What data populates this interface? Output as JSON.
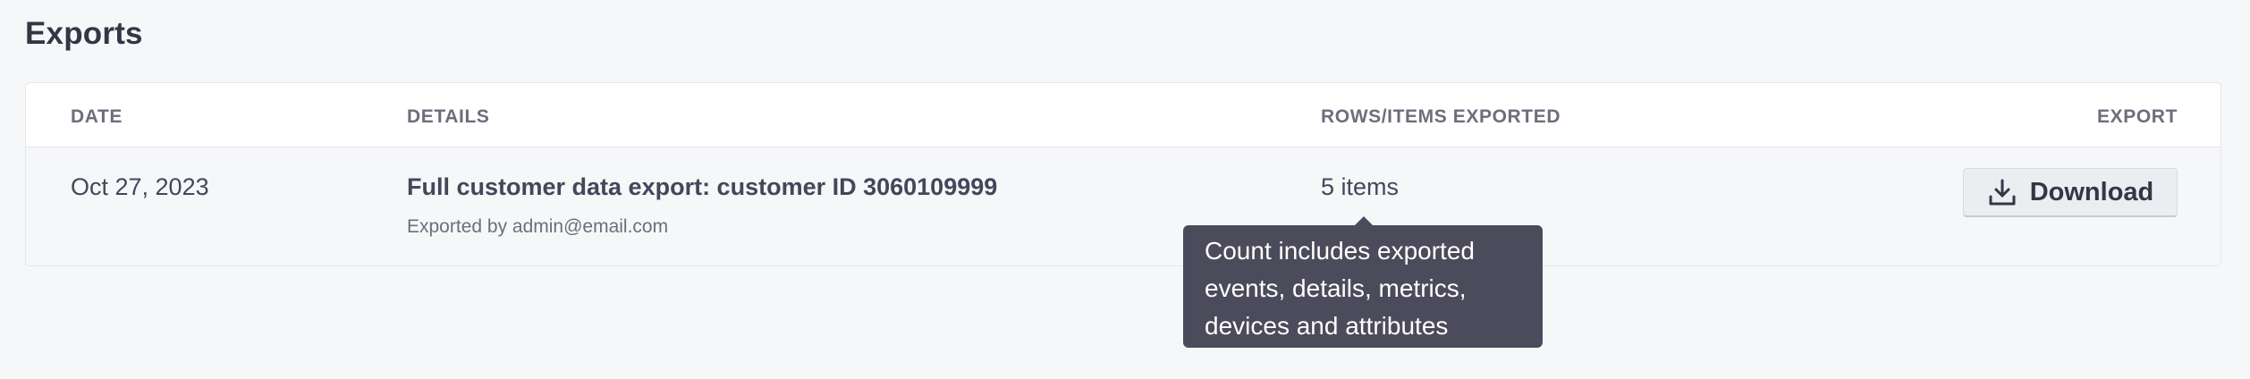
{
  "page": {
    "title": "Exports"
  },
  "table": {
    "headers": {
      "date": "DATE",
      "details": "DETAILS",
      "rows": "ROWS/ITEMS EXPORTED",
      "export": "EXPORT"
    },
    "rows": [
      {
        "date": "Oct 27, 2023",
        "details_title": "Full customer data export: customer ID 3060109999",
        "details_sub": "Exported by admin@email.com",
        "rows_exported": "5 items",
        "export_label": "Download",
        "export_icon": "download-icon"
      }
    ]
  },
  "tooltip": {
    "lines": [
      "Count includes exported",
      "events, details, metrics,",
      "devices and attributes"
    ]
  },
  "colors": {
    "background": "#f6f7f9",
    "tooltip_bg": "#4b4b5b",
    "button_bg": "#ecedf1"
  }
}
